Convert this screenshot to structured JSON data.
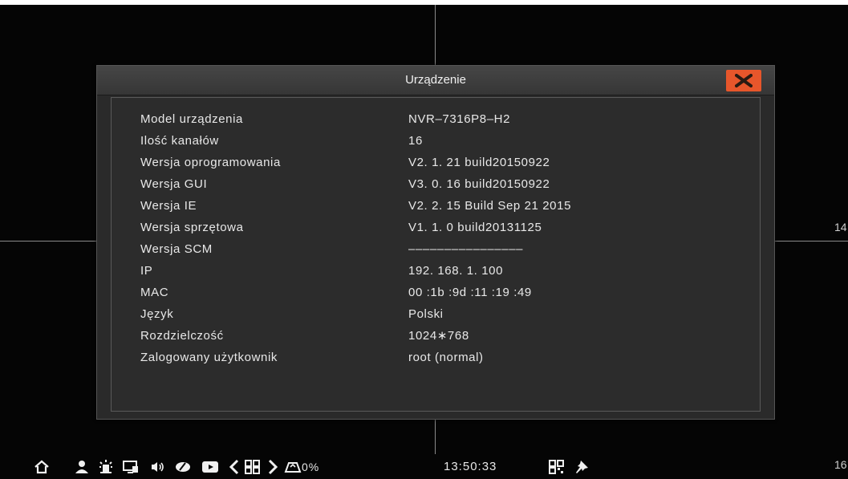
{
  "dialog": {
    "title": "Urządzenie",
    "rows": [
      {
        "label": "Model urządzenia",
        "value": "NVR–7316P8–H2"
      },
      {
        "label": "Ilość kanałów",
        "value": "16"
      },
      {
        "label": "Wersja oprogramowania",
        "value": "V2. 1. 21 build20150922"
      },
      {
        "label": "Wersja GUI",
        "value": "V3. 0. 16 build20150922"
      },
      {
        "label": "Wersja IE",
        "value": "V2. 2. 15 Build Sep 21 2015"
      },
      {
        "label": "Wersja sprzętowa",
        "value": "V1. 1. 0 build20131125"
      },
      {
        "label": "Wersja SCM",
        "value": "––––––––––––––––"
      },
      {
        "label": "IP",
        "value": "192. 168. 1. 100"
      },
      {
        "label": "MAC",
        "value": "00 :1b :9d :11 :19 :49"
      },
      {
        "label": "Język",
        "value": "Polski"
      },
      {
        "label": "Rozdzielczość",
        "value": "1024∗768"
      },
      {
        "label": "Zalogowany użytkownik",
        "value": "root (normal)"
      }
    ]
  },
  "background": {
    "channel_labels": [
      "14",
      "16"
    ]
  },
  "taskbar": {
    "disk_usage": "0%",
    "clock": "13:50:33",
    "icons": [
      "home-icon",
      "user-icon",
      "alarm-icon",
      "monitor-icon",
      "speaker-icon",
      "ptz-icon",
      "playback-icon",
      "prev-page-icon",
      "grid-layout-icon",
      "next-page-icon",
      "disk-icon",
      "qr-code-icon",
      "pin-icon"
    ]
  },
  "colors": {
    "dialog_bg": "#2a2a2a",
    "titlebar_bg": "#3e3e3e",
    "close_button": "#e7562b",
    "text": "#e8e8e8"
  }
}
